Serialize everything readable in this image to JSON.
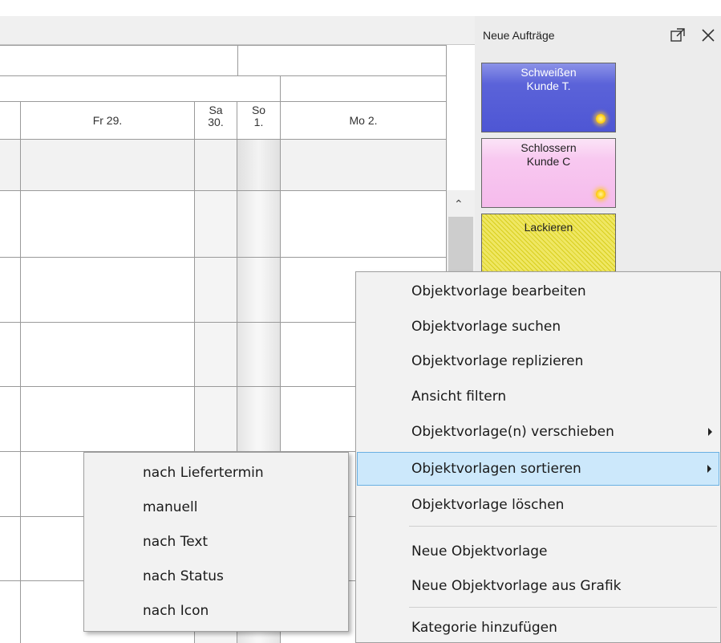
{
  "scheduler": {
    "days": [
      {
        "label": "Fr 29."
      },
      {
        "label": "Sa\n30."
      },
      {
        "label": "So\n1."
      },
      {
        "label": "Mo 2."
      }
    ]
  },
  "panel": {
    "title": "Neue Aufträge",
    "cards": [
      {
        "line1": "Schweißen",
        "line2": "Kunde T.",
        "color": "#5b63d9"
      },
      {
        "line1": "Schlossern",
        "line2": "Kunde C",
        "color": "#f8c8f0"
      },
      {
        "line1": "Lackieren",
        "line2": "",
        "color": "#e9e24a"
      }
    ]
  },
  "context_menu": {
    "items": [
      {
        "label": "Objektvorlage bearbeiten"
      },
      {
        "label": "Objektvorlage suchen"
      },
      {
        "label": "Objektvorlage replizieren"
      },
      {
        "label": "Ansicht filtern"
      },
      {
        "label": "Objektvorlage(n) verschieben"
      },
      {
        "label": "Objektvorlagen sortieren"
      },
      {
        "label": "Objektvorlage löschen"
      },
      {
        "label": "Neue Objektvorlage"
      },
      {
        "label": "Neue Objektvorlage aus Grafik"
      },
      {
        "label": "Kategorie hinzufügen"
      }
    ],
    "selected_label": "Objektvorlagen sortieren"
  },
  "sort_submenu": {
    "items": [
      {
        "label": "nach Liefertermin"
      },
      {
        "label": "manuell"
      },
      {
        "label": "nach Text"
      },
      {
        "label": "nach Status"
      },
      {
        "label": "nach Icon"
      }
    ]
  },
  "colors": {
    "menu_highlight": "#cce8fb",
    "menu_highlight_border": "#6ab0e2",
    "panel_background": "#ececec"
  },
  "icons": {
    "popout": "external-window-icon",
    "close": "close-icon",
    "scroll_up": "chevron-up-icon",
    "submenu": "submenu-arrow-icon",
    "new_badge": "sun-icon"
  }
}
